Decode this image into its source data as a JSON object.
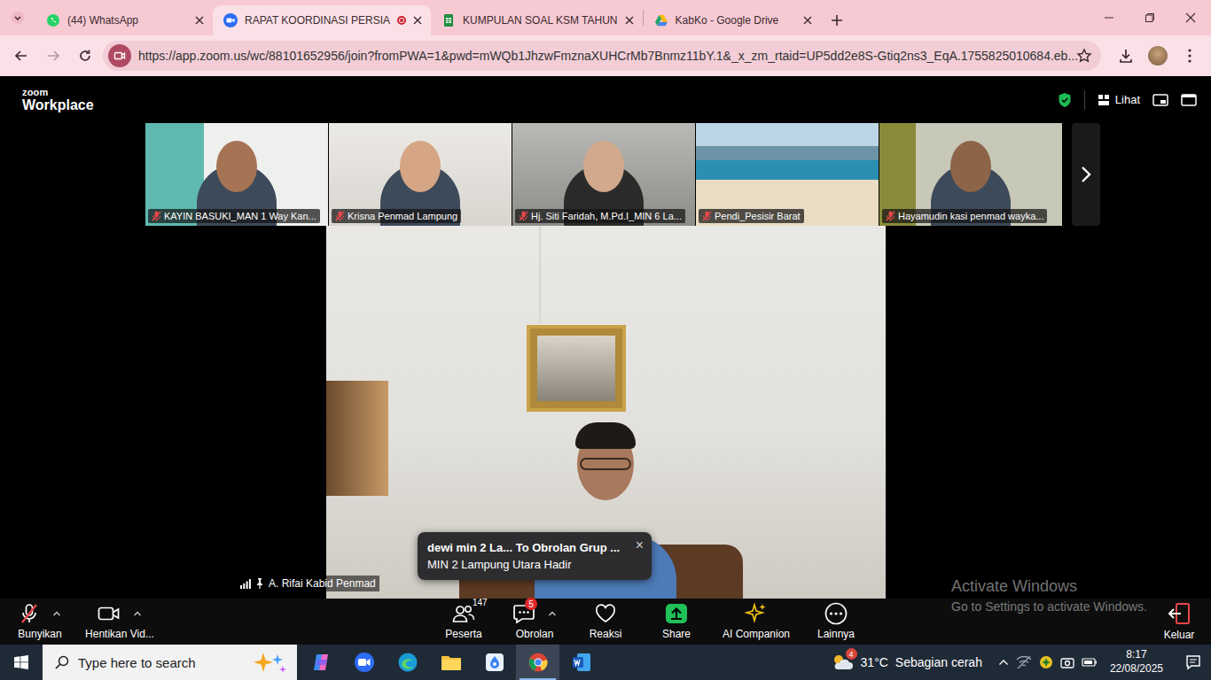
{
  "browser": {
    "tabs": [
      {
        "label": "(44) WhatsApp",
        "selected": false,
        "recording": false
      },
      {
        "label": "RAPAT KOORDINASI PERSIA",
        "selected": true,
        "recording": true
      },
      {
        "label": "KUMPULAN SOAL KSM TAHUN",
        "selected": false,
        "recording": false
      },
      {
        "label": "KabKo - Google Drive",
        "selected": false,
        "recording": false
      }
    ],
    "url": "https://app.zoom.us/wc/88101652956/join?fromPWA=1&pwd=mWQb1JhzwFmznaXUHCrMb7Bnmz11bY.1&_x_zm_rtaid=UP5dd2e8S-Gtiq2ns3_EqA.1755825010684.eb..."
  },
  "zoom": {
    "brand": {
      "small": "zoom",
      "large": "Workplace"
    },
    "view_button": "Lihat",
    "participants": [
      {
        "name": "KAYIN BASUKI_MAN 1 Way Kan...",
        "muted": true
      },
      {
        "name": "Krisna Penmad Lampung",
        "muted": true
      },
      {
        "name": "Hj. Siti Faridah, M.Pd.I_MIN 6 La...",
        "muted": true
      },
      {
        "name": "Pendi_Pesisir Barat",
        "muted": true
      },
      {
        "name": "Hayamudin kasi penmad wayka...",
        "muted": true
      }
    ],
    "active_speaker": {
      "name": "A. Rifai Kabid Penmad",
      "pinned": true
    },
    "chat_toast": {
      "title": "dewi min 2 La... To Obrolan Grup ...",
      "message": "MIN 2 Lampung Utara Hadir",
      "close": "×"
    },
    "toolbar": [
      {
        "label": "Bunyikan",
        "kind": "mic",
        "muted": true,
        "menu": true
      },
      {
        "label": "Hentikan Vid...",
        "kind": "video",
        "menu": true
      },
      {
        "label": "Peserta",
        "kind": "participants",
        "count": "147",
        "menu": false
      },
      {
        "label": "Obrolan",
        "kind": "chat",
        "badge": "5",
        "menu": true
      },
      {
        "label": "Reaksi",
        "kind": "reaction",
        "menu": false
      },
      {
        "label": "Share",
        "kind": "share",
        "menu": false
      },
      {
        "label": "AI Companion",
        "kind": "ai",
        "menu": false
      },
      {
        "label": "Lainnya",
        "kind": "more",
        "menu": false
      }
    ],
    "leave": "Keluar"
  },
  "watermark": {
    "title": "Activate Windows",
    "subtitle": "Go to Settings to activate Windows."
  },
  "taskbar": {
    "search_placeholder": "Type here to search",
    "weather": {
      "badge": "4",
      "temperature": "31°C",
      "condition": "Sebagian cerah"
    },
    "time": "8:17",
    "date": "22/08/2025"
  }
}
